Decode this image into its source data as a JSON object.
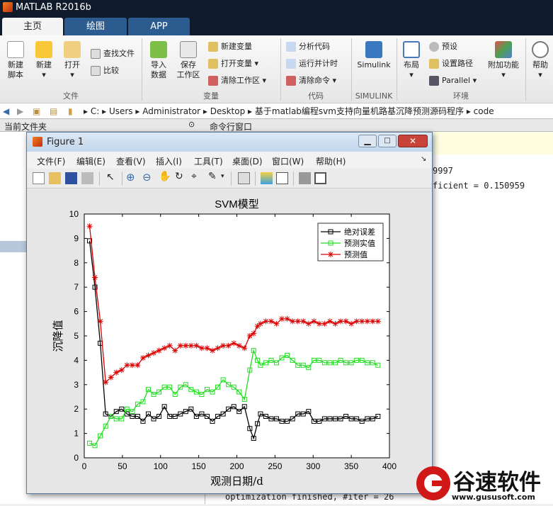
{
  "app": {
    "title": "MATLAB R2016b"
  },
  "tabs": [
    {
      "label": "主页"
    },
    {
      "label": "绘图"
    },
    {
      "label": "APP"
    }
  ],
  "ribbon": {
    "new_script": [
      "新建",
      "脚本"
    ],
    "new": "新建",
    "open": "打开",
    "find_files": "查找文件",
    "compare": "比较",
    "import": [
      "导入",
      "数据"
    ],
    "save_ws": [
      "保存",
      "工作区"
    ],
    "new_var": "新建变量",
    "open_var": "打开变量",
    "clear_ws": "清除工作区",
    "analyze": "分析代码",
    "run_time": "运行并计时",
    "clear_cmd": "清除命令",
    "simulink": "Simulink",
    "layout": "布局",
    "prefs": "预设",
    "set_path": "设置路径",
    "parallel": "Parallel",
    "addons": "附加功能",
    "help": "帮助",
    "sections": {
      "file": "文件",
      "variable": "变量",
      "code": "代码",
      "simulink": "SIMULINK",
      "env": "环境"
    }
  },
  "address": {
    "path": [
      "C:",
      "Users",
      "Administrator",
      "Desktop",
      "基于matlab编程svm支持向量机路基沉降预测源码程序",
      "code"
    ]
  },
  "panels": {
    "current_folder": "当前文件夹",
    "command_window": "命令行窗口"
  },
  "command": {
    "line1": "9997",
    "line2": "ficient = 0.150959",
    "last": "optimization finished, #iter = 26"
  },
  "figure": {
    "title": "Figure 1",
    "menu": [
      "文件(F)",
      "编辑(E)",
      "查看(V)",
      "插入(I)",
      "工具(T)",
      "桌面(D)",
      "窗口(W)",
      "帮助(H)"
    ]
  },
  "chart_data": {
    "type": "line",
    "title": "SVM模型",
    "xlabel": "观测日期/d",
    "ylabel": "沉降值",
    "xlim": [
      0,
      400
    ],
    "ylim": [
      0,
      10
    ],
    "xticks": [
      0,
      50,
      100,
      150,
      200,
      250,
      300,
      350,
      400
    ],
    "yticks": [
      0,
      1,
      2,
      3,
      4,
      5,
      6,
      7,
      8,
      9,
      10
    ],
    "grid": false,
    "legend_position": "top-right",
    "x": [
      7,
      14,
      21,
      28,
      35,
      42,
      49,
      56,
      63,
      70,
      77,
      84,
      91,
      98,
      105,
      112,
      119,
      126,
      133,
      140,
      147,
      154,
      161,
      168,
      175,
      182,
      189,
      196,
      203,
      210,
      217,
      222,
      227,
      231,
      238,
      245,
      252,
      259,
      266,
      273,
      280,
      287,
      294,
      301,
      308,
      315,
      322,
      329,
      336,
      343,
      350,
      357,
      364,
      371,
      378,
      385
    ],
    "series": [
      {
        "name": "绝对误差",
        "color": "#000000",
        "marker": "square",
        "values": [
          8.9,
          7.0,
          4.7,
          1.8,
          1.7,
          1.9,
          2.0,
          1.8,
          1.7,
          1.7,
          1.5,
          1.8,
          1.6,
          1.7,
          2.1,
          1.7,
          1.7,
          1.8,
          1.9,
          2.0,
          1.7,
          1.8,
          1.7,
          1.5,
          1.7,
          1.8,
          2.0,
          2.1,
          1.9,
          2.1,
          1.2,
          0.8,
          1.4,
          1.8,
          1.7,
          1.6,
          1.6,
          1.5,
          1.5,
          1.6,
          1.8,
          1.8,
          1.9,
          1.5,
          1.5,
          1.6,
          1.6,
          1.6,
          1.6,
          1.7,
          1.6,
          1.6,
          1.5,
          1.6,
          1.6,
          1.7
        ]
      },
      {
        "name": "预测实值",
        "color": "#22dd22",
        "marker": "square",
        "values": [
          0.6,
          0.5,
          0.9,
          1.3,
          1.7,
          1.6,
          1.6,
          2.0,
          1.9,
          2.2,
          2.3,
          2.8,
          2.6,
          2.7,
          2.9,
          2.9,
          2.6,
          2.9,
          3.0,
          2.8,
          2.7,
          2.6,
          2.8,
          2.7,
          2.9,
          3.2,
          3.0,
          2.9,
          2.7,
          2.4,
          3.6,
          4.4,
          4.0,
          3.8,
          3.9,
          4.0,
          3.9,
          4.1,
          4.2,
          4.0,
          3.8,
          3.8,
          3.7,
          4.0,
          4.0,
          3.9,
          3.9,
          3.9,
          4.0,
          3.9,
          3.9,
          4.0,
          4.0,
          3.9,
          3.9,
          3.8
        ]
      },
      {
        "name": "预测值",
        "color": "#dd0000",
        "marker": "star",
        "values": [
          9.5,
          7.4,
          5.6,
          3.1,
          3.3,
          3.5,
          3.6,
          3.8,
          3.8,
          3.8,
          4.1,
          4.2,
          4.3,
          4.4,
          4.5,
          4.6,
          4.4,
          4.6,
          4.6,
          4.6,
          4.6,
          4.5,
          4.5,
          4.4,
          4.5,
          4.6,
          4.6,
          4.7,
          4.6,
          4.5,
          5.0,
          5.1,
          5.4,
          5.5,
          5.6,
          5.6,
          5.5,
          5.7,
          5.7,
          5.6,
          5.6,
          5.6,
          5.5,
          5.6,
          5.5,
          5.5,
          5.6,
          5.5,
          5.6,
          5.6,
          5.5,
          5.6,
          5.6,
          5.6,
          5.6,
          5.6
        ]
      }
    ]
  },
  "watermark": {
    "brand": "谷速软件",
    "url": "www.gususoft.com"
  }
}
